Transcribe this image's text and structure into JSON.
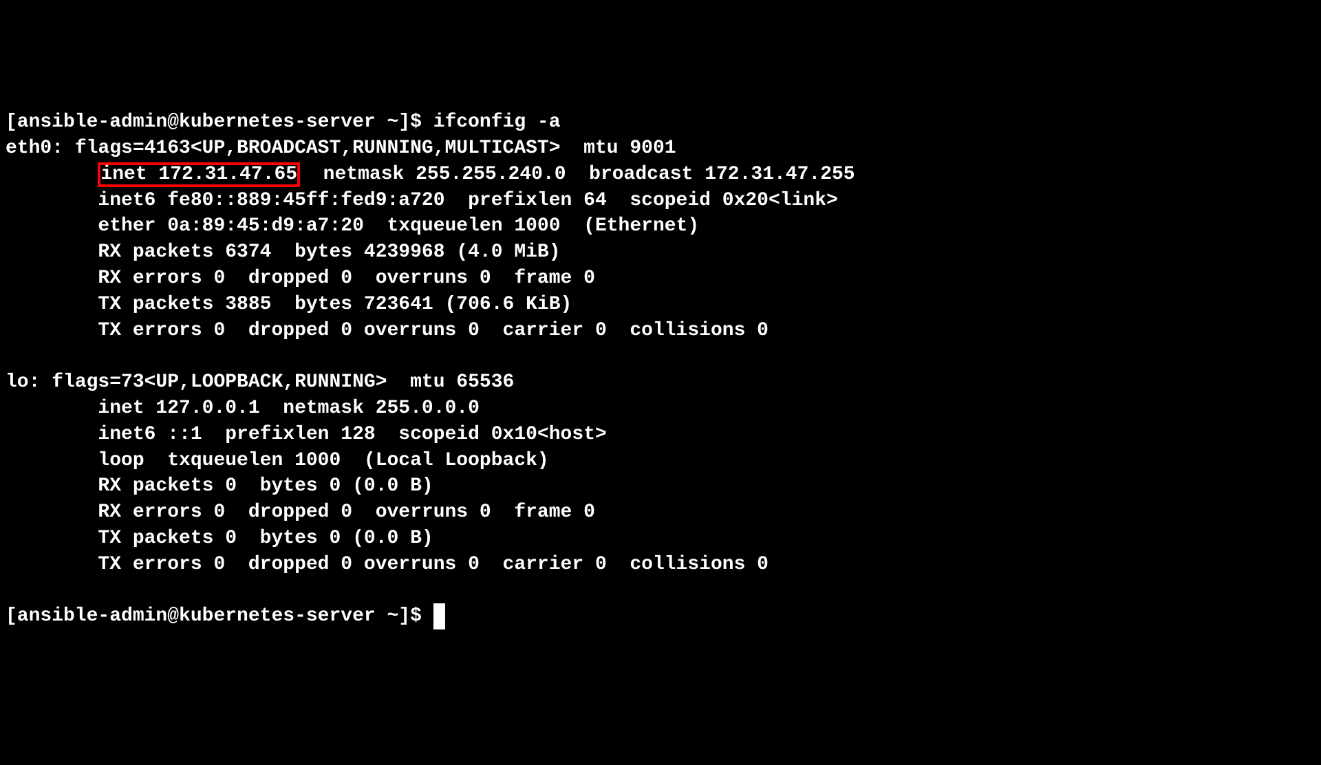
{
  "prompt1": "[ansible-admin@kubernetes-server ~]$ ",
  "command": "ifconfig -a",
  "eth0": {
    "header": "eth0: flags=4163<UP,BROADCAST,RUNNING,MULTICAST>  mtu 9001",
    "inet_prefix": "        ",
    "inet_highlight": "inet 172.31.47.65",
    "inet_suffix": "  netmask 255.255.240.0  broadcast 172.31.47.255",
    "inet6": "        inet6 fe80::889:45ff:fed9:a720  prefixlen 64  scopeid 0x20<link>",
    "ether": "        ether 0a:89:45:d9:a7:20  txqueuelen 1000  (Ethernet)",
    "rxp": "        RX packets 6374  bytes 4239968 (4.0 MiB)",
    "rxe": "        RX errors 0  dropped 0  overruns 0  frame 0",
    "txp": "        TX packets 3885  bytes 723641 (706.6 KiB)",
    "txe": "        TX errors 0  dropped 0 overruns 0  carrier 0  collisions 0"
  },
  "lo": {
    "header": "lo: flags=73<UP,LOOPBACK,RUNNING>  mtu 65536",
    "inet": "        inet 127.0.0.1  netmask 255.0.0.0",
    "inet6": "        inet6 ::1  prefixlen 128  scopeid 0x10<host>",
    "loop": "        loop  txqueuelen 1000  (Local Loopback)",
    "rxp": "        RX packets 0  bytes 0 (0.0 B)",
    "rxe": "        RX errors 0  dropped 0  overruns 0  frame 0",
    "txp": "        TX packets 0  bytes 0 (0.0 B)",
    "txe": "        TX errors 0  dropped 0 overruns 0  carrier 0  collisions 0"
  },
  "prompt2": "[ansible-admin@kubernetes-server ~]$ ",
  "cursor": " "
}
